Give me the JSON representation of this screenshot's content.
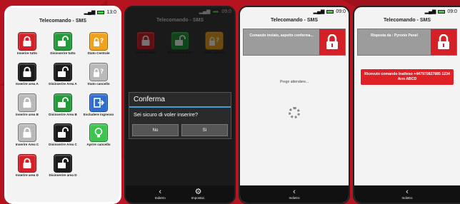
{
  "status_time": "13:0",
  "status_time_2": "09:0",
  "app_title": "Telecomando - SMS",
  "grid_items": [
    {
      "label": "Inserire tutto",
      "icon": "padlock-locked-icon",
      "color": "red"
    },
    {
      "label": "Disinserire tutto",
      "icon": "padlock-open-icon",
      "color": "green"
    },
    {
      "label": "Stato Centrale",
      "icon": "padlock-question-icon",
      "color": "orange"
    },
    {
      "label": "Inserire area A",
      "icon": "padlock-locked-icon",
      "color": "black"
    },
    {
      "label": "Disinserire Area A",
      "icon": "padlock-open-icon",
      "color": "black"
    },
    {
      "label": "Stato cancello",
      "icon": "padlock-question-icon",
      "color": "grey"
    },
    {
      "label": "Inserire area B",
      "icon": "padlock-locked-icon",
      "color": "grey"
    },
    {
      "label": "Disinserire Area B",
      "icon": "padlock-open-icon",
      "color": "green"
    },
    {
      "label": "Escludere ingresso",
      "icon": "exit-door-icon",
      "color": "blue"
    },
    {
      "label": "Inserire Area C",
      "icon": "padlock-locked-icon",
      "color": "grey"
    },
    {
      "label": "Disinserire Area C",
      "icon": "padlock-open-icon",
      "color": "black"
    },
    {
      "label": "Aprire cancello",
      "icon": "lightbulb-icon",
      "color": "lime"
    },
    {
      "label": "Inserire area D",
      "icon": "padlock-locked-icon",
      "color": "red"
    },
    {
      "label": "Disinserire area D",
      "icon": "padlock-open-icon",
      "color": "black"
    }
  ],
  "screen2_items": [
    {
      "label": "Inserire tutto",
      "color": "red"
    },
    {
      "label": "Disinserire tutto",
      "color": "green"
    },
    {
      "label": "Stato centrale",
      "color": "orange"
    }
  ],
  "dialog": {
    "title": "Conferma",
    "message": "Sei sicuro di voler inserire?",
    "no_label": "No",
    "yes_label": "Sì"
  },
  "nav": {
    "back_label": "Indietro",
    "settings_label": "Impostaz."
  },
  "screen3": {
    "notice": "Comando inviato, aspetto conferma...",
    "wait_text": "Prego attendere..."
  },
  "screen4": {
    "notice": "Risposta da : Pyronix Panel",
    "alert": "Ricevuto comando Inatteso +447970827885 1234 Arm ABCD"
  },
  "colors": {
    "brand_red": "#d52027",
    "background": "#b5131f",
    "accent": "#3aa0d8"
  }
}
